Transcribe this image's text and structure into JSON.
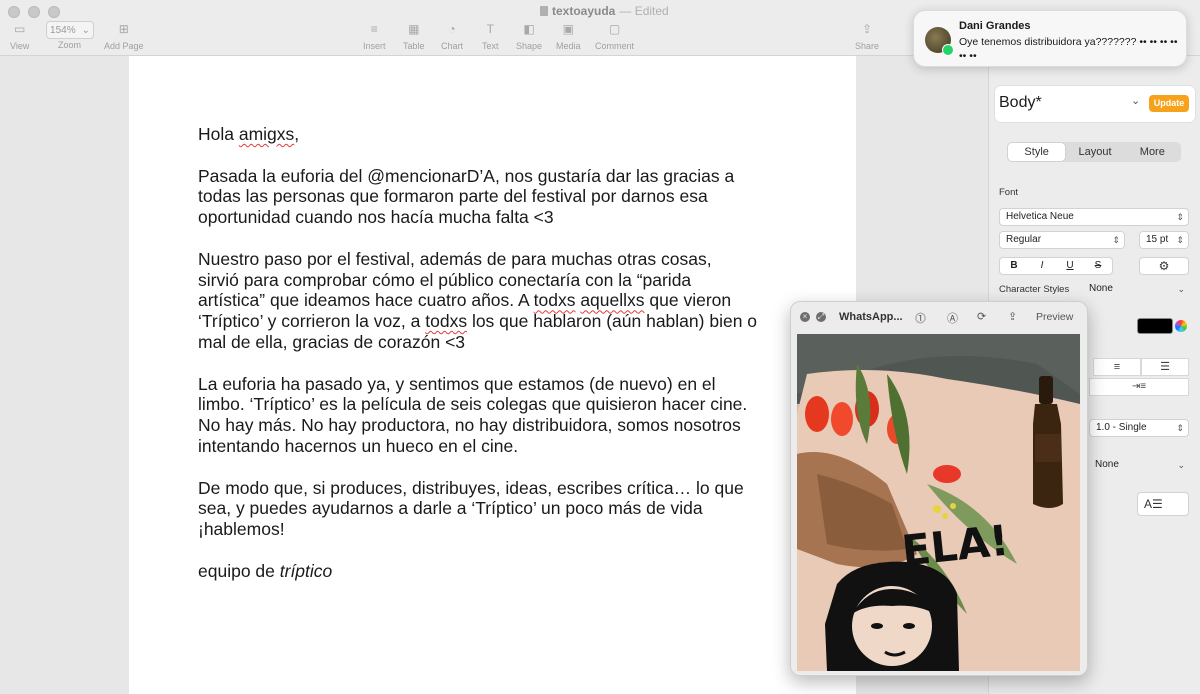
{
  "window": {
    "title": "textoayuda",
    "status": "Edited"
  },
  "toolbar": {
    "view_label": "View",
    "zoom_value": "154%",
    "zoom_label": "Zoom",
    "add_page_label": "Add Page",
    "insert_label": "Insert",
    "table_label": "Table",
    "chart_label": "Chart",
    "text_label": "Text",
    "shape_label": "Shape",
    "media_label": "Media",
    "comment_label": "Comment",
    "share_label": "Share"
  },
  "document": {
    "greeting_pre": "Hola ",
    "greeting_word": "amigxs",
    "greeting_post": ",",
    "p1": [
      "Pasada la euforia del @mencionarD’A, nos gustaría dar las gracias a",
      "todas las personas que formaron parte del festival por darnos esa",
      "oportunidad cuando nos hacía mucha falta <3"
    ],
    "p2_l1": "Nuestro paso por el festival, además de para muchas otras cosas,",
    "p2_l2": "sirvió para comprobar cómo el público conectaría con la “parida",
    "p2_l3_a": "artística” que ideamos hace cuatro años. A ",
    "p2_l3_w1": "todxs",
    "p2_l3_b": " ",
    "p2_l3_w2": "aquellxs",
    "p2_l3_c": " que vieron",
    "p2_l4_a": "‘Tríptico’ y corrieron la voz, a ",
    "p2_l4_w": "todxs",
    "p2_l4_b": " los que hablaron (aún hablan) bien o",
    "p2_l5": "mal de ella, gracias de corazón <3",
    "p3": [
      "La euforia ha pasado ya, y sentimos que estamos (de nuevo) en el",
      "limbo. ‘Tríptico’ es la película de seis colegas que quisieron hacer cine.",
      "No hay más. No hay productora, no hay distribuidora, somos nosotros",
      "intentando hacernos un hueco en el cine."
    ],
    "p4": [
      "De modo que, si produces, distribuyes, ideas, escribes crítica… lo que",
      "sea, y puedes ayudarnos a darle a ‘Tríptico’ un poco más de vida",
      "¡hablemos!"
    ],
    "sign_pre": "equipo de ",
    "sign_it": "tríptico"
  },
  "inspector": {
    "paragraph_style": "Body*",
    "update_label": "Update",
    "tabs": [
      "Style",
      "Layout",
      "More"
    ],
    "font_heading": "Font",
    "font_family": "Helvetica Neue",
    "font_weight": "Regular",
    "font_size": "15 pt",
    "bold": "B",
    "italic": "I",
    "underline": "U",
    "strike": "S",
    "character_styles_label": "Character Styles",
    "character_styles_value": "None",
    "line_spacing": "1.0 - Single",
    "bullets_value": "None"
  },
  "notification": {
    "sender": "Dani Grandes",
    "message": "Oye tenemos distribuidora ya??????? •• •• •• •• •• ••"
  },
  "preview": {
    "title": "WhatsApp...",
    "open_label": "Preview",
    "shirt_text": "ELA!"
  }
}
